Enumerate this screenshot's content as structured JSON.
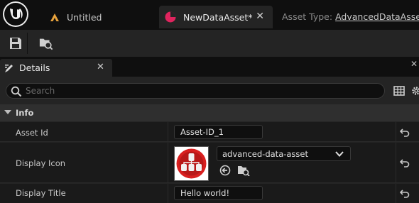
{
  "tabs": {
    "untitled_label": "Untitled",
    "asset_label": "NewDataAsset*",
    "asset_type_key": "Asset Type:",
    "asset_type_value": "AdvancedDataAsset"
  },
  "details": {
    "tab_label": "Details",
    "search_placeholder": "Search"
  },
  "category": {
    "label": "Info"
  },
  "properties": [
    {
      "name": "Asset Id",
      "value": "Asset-ID_1"
    },
    {
      "name": "Display Icon",
      "value": "advanced-data-asset"
    },
    {
      "name": "Display Title",
      "value": "Hello world!"
    }
  ],
  "colors": {
    "accent_pink": "#e0245e",
    "untitled_icon": "#e8a33d",
    "panel_bg": "#242424",
    "row_bg": "#1a1a1a"
  },
  "icons": [
    "unreal-logo-icon",
    "level-icon",
    "data-asset-icon",
    "close-icon",
    "save-icon",
    "browse-icon",
    "details-icon",
    "search-icon",
    "grid-icon",
    "gear-icon",
    "reset-icon",
    "chevron-down-icon",
    "use-arrow-icon"
  ]
}
